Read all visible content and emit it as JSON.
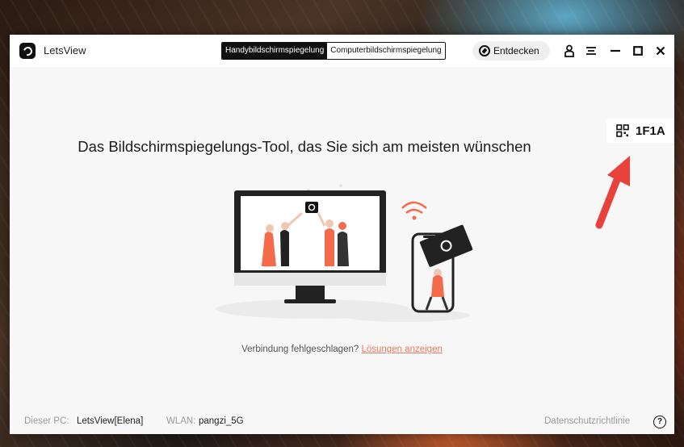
{
  "app": {
    "name": "LetsView"
  },
  "mode_tabs": [
    {
      "label": "Handybildschirmspiegelung",
      "active": true
    },
    {
      "label": "Computerbildschirmspiegelung",
      "active": false
    }
  ],
  "discover": {
    "label": "Entdecken"
  },
  "window_controls": {
    "icons": [
      "user-icon",
      "menu-icon",
      "minimize-icon",
      "maximize-icon",
      "close-icon"
    ]
  },
  "qr": {
    "icon": "qr-code-icon",
    "code": "1F1A"
  },
  "main": {
    "headline": "Das Bildschirmspiegelungs-Tool, das Sie sich am meisten wünschen",
    "failed_text": "Verbindung fehlgeschlagen?",
    "failed_link": "Lösungen anzeigen"
  },
  "status": {
    "pc_label": "Dieser PC:",
    "pc_value": "LetsView[Elena]",
    "wlan_label": "WLAN:",
    "wlan_value": "pangzi_5G",
    "privacy": "Datenschutzrichtlinie",
    "help": "?"
  },
  "colors": {
    "accent_link": "#e97a5f",
    "arrow": "#e8423b",
    "dark": "#111111"
  }
}
